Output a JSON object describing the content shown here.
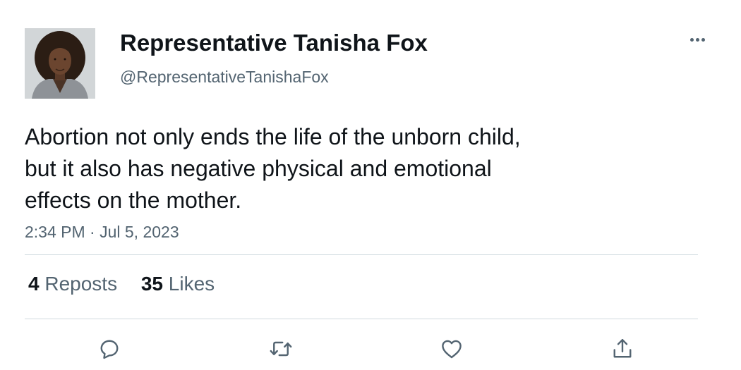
{
  "author": {
    "name": "Representative Tanisha Fox",
    "handle": "@RepresentativeTanishaFox"
  },
  "post": {
    "lines": [
      "Abortion not only ends the life of the unborn child,",
      "but it also has negative physical and emotional",
      "effects on the mother."
    ],
    "timestamp": "2:34 PM · Jul 5, 2023"
  },
  "stats": {
    "reposts_count": "4",
    "reposts_label": "Reposts",
    "likes_count": "35",
    "likes_label": "Likes"
  },
  "actions": [
    "reply-icon",
    "repost-icon",
    "like-icon",
    "share-icon"
  ],
  "colors": {
    "text_primary": "#0f1419",
    "text_secondary": "#536471",
    "divider": "#cfd9de"
  }
}
